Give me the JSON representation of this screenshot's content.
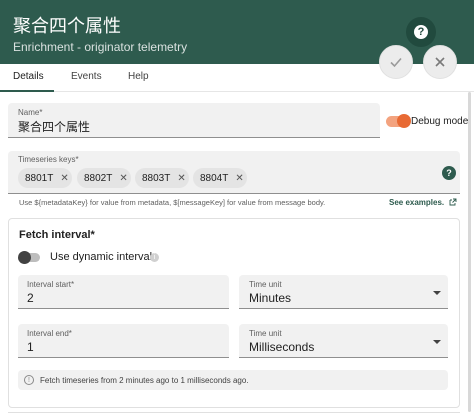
{
  "header": {
    "title": "聚合四个属性",
    "subtitle": "Enrichment - originator telemetry",
    "help_icon": "question-icon",
    "apply_icon": "check-icon",
    "close_icon": "close-icon",
    "color": "#2e5b4e"
  },
  "tabs": [
    {
      "label": "Details",
      "active": true
    },
    {
      "label": "Events",
      "active": false
    },
    {
      "label": "Help",
      "active": false
    }
  ],
  "name_field": {
    "label": "Name*",
    "value": "聚合四个属性"
  },
  "debug_mode": {
    "label": "Debug mode",
    "on": true,
    "color": "#e86a34"
  },
  "timeseries_keys": {
    "label": "Timeseries keys*",
    "chips": [
      "8801T",
      "8802T",
      "8803T",
      "8804T"
    ],
    "remove_icon": "close-icon",
    "help_icon": "question-circle-icon",
    "help_text": "Use ${metadataKey} for value from metadata, $[messageKey] for value from message body.",
    "examples_link": "See examples."
  },
  "fetch_interval": {
    "title": "Fetch interval*",
    "dynamic_label": "Use dynamic interval",
    "dynamic_on": false,
    "info_icon": "info-icon",
    "interval_start": {
      "label": "Interval start*",
      "value": "2"
    },
    "start_unit": {
      "label": "Time unit",
      "value": "Minutes"
    },
    "interval_end": {
      "label": "Interval end*",
      "value": "1"
    },
    "end_unit": {
      "label": "Time unit",
      "value": "Milliseconds"
    },
    "note_icon": "clock-icon",
    "note": "Fetch timeseries from 2 minutes ago to 1 milliseconds ago."
  }
}
